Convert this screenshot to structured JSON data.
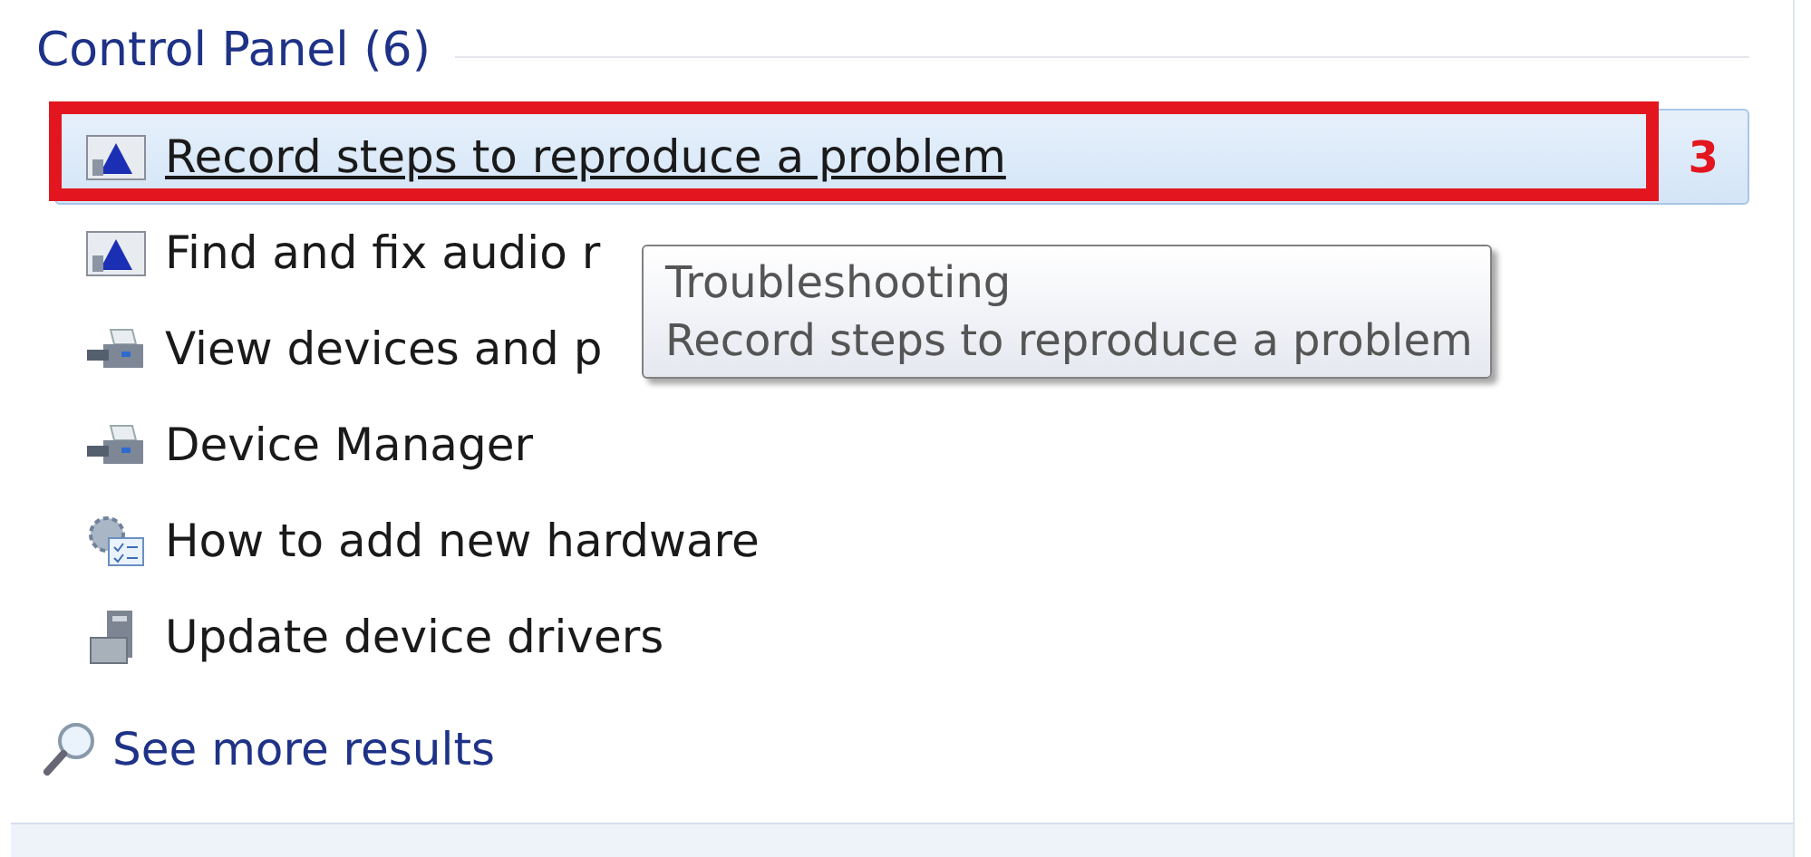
{
  "group": {
    "title": "Control Panel (6)"
  },
  "results": [
    {
      "label": "Record steps to reproduce a problem",
      "kind": "troubleshoot",
      "selected": true
    },
    {
      "label": "Find and fix audio r",
      "kind": "troubleshoot",
      "selected": false
    },
    {
      "label": "View devices and p",
      "kind": "devices",
      "selected": false
    },
    {
      "label": "Device Manager",
      "kind": "devices",
      "selected": false
    },
    {
      "label": "How to add new hardware",
      "kind": "help",
      "selected": false
    },
    {
      "label": "Update device drivers",
      "kind": "driver",
      "selected": false
    }
  ],
  "annotation": {
    "label": "3"
  },
  "tooltip": {
    "title": "Troubleshooting",
    "text": "Record steps to reproduce a problem"
  },
  "see_more": {
    "label": "See more results"
  }
}
